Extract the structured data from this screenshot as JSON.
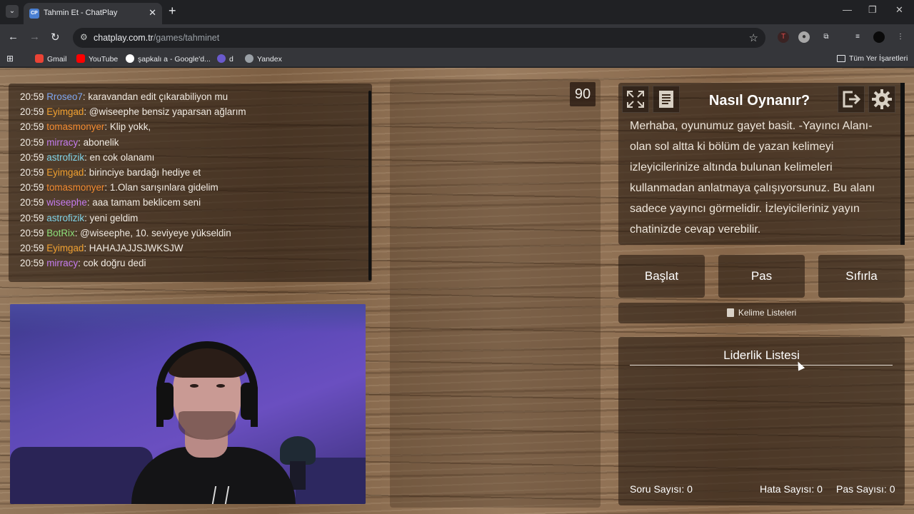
{
  "browser": {
    "tab_title": "Tahmin Et - ChatPlay",
    "tab_favicon": "CP",
    "url_host": "chatplay.com.tr",
    "url_path": "/games/tahminet",
    "bookmarks": [
      {
        "label": "Gmail",
        "icon": "gmail-icon",
        "color": "#ea4335"
      },
      {
        "label": "YouTube",
        "icon": "youtube-icon",
        "color": "#ff0000"
      },
      {
        "label": "şapkalı a - Google'd...",
        "icon": "google-icon",
        "color": "#ffffff"
      },
      {
        "label": "d",
        "icon": "bookmark-icon",
        "color": "#6a5acd"
      },
      {
        "label": "Yandex",
        "icon": "globe-icon",
        "color": "#9aa0a6"
      }
    ],
    "all_bookmarks": "Tüm Yer İşaretleri"
  },
  "chat": {
    "messages": [
      {
        "time": "20:59",
        "user": "Rroseo7",
        "color": "#7ea6f0",
        "text": ": karavandan edit çıkarabiliyon mu"
      },
      {
        "time": "20:59",
        "user": "Eyimgad",
        "color": "#f0a030",
        "text": ": @wiseephe bensiz yaparsan ağlarım"
      },
      {
        "time": "20:59",
        "user": "tomasmonyer",
        "color": "#f28a30",
        "text": ": Klip yokk,"
      },
      {
        "time": "20:59",
        "user": "mirracy",
        "color": "#c57cf0",
        "text": ": abonelik"
      },
      {
        "time": "20:59",
        "user": "astrofizik",
        "color": "#7fd3e8",
        "text": ": en cok olanamı"
      },
      {
        "time": "20:59",
        "user": "Eyimgad",
        "color": "#f0a030",
        "text": ": birinciye bardağı hediye et"
      },
      {
        "time": "20:59",
        "user": "tomasmonyer",
        "color": "#f28a30",
        "text": ": 1.Olan sarışınlara gidelim"
      },
      {
        "time": "20:59",
        "user": "wiseephe",
        "color": "#c57cf0",
        "text": ": aaa tamam beklicem seni"
      },
      {
        "time": "20:59",
        "user": "astrofizik",
        "color": "#7fd3e8",
        "text": ": yeni geldim"
      },
      {
        "time": "20:59",
        "user": "BotRix",
        "color": "#8ee07a",
        "text": ": @wiseephe, 10. seviyeye yükseldin"
      },
      {
        "time": "20:59",
        "user": "Eyimgad",
        "color": "#f0a030",
        "text": ": HAHAJAJJSJWKSJW"
      },
      {
        "time": "20:59",
        "user": "mirracy",
        "color": "#c57cf0",
        "text": ": cok doğru dedi"
      }
    ]
  },
  "timer": "90",
  "howto": {
    "title": "Nasıl Oynanır?",
    "text": "Merhaba, oyunumuz gayet basit. -Yayıncı Alanı- olan sol altta ki bölüm de yazan kelimeyi izleyicilerinize altında bulunan kelimeleri kullanmadan anlatmaya çalışıyorsunuz. Bu alanı sadece yayıncı görmelidir. İzleyicileriniz yayın chatinizde cevap verebilir."
  },
  "controls": {
    "start": "Başlat",
    "pass": "Pas",
    "reset": "Sıfırla"
  },
  "word_lists": "Kelime Listeleri",
  "leaderboard": {
    "title": "Liderlik Listesi",
    "question_count": "Soru Sayısı: 0",
    "error_count": "Hata Sayısı: 0",
    "pass_count": "Pas Sayısı: 0"
  }
}
